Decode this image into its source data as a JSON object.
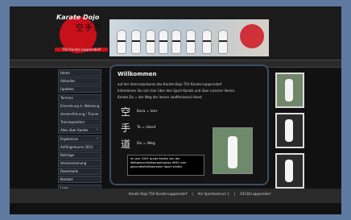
{
  "header": {
    "logo_title": "Karate Dojo",
    "logo_kanji": "空手道",
    "logo_club": "TSV Karate-Lappersdorf"
  },
  "nav": {
    "items": [
      {
        "label": "Home",
        "sub": false
      },
      {
        "label": "Aktuelles",
        "sub": false
      },
      {
        "label": "Updates",
        "sub": false
      },
      {
        "label": "Termine",
        "sub": false
      },
      {
        "label": "Einordnung d. Abteilung",
        "sub": false
      },
      {
        "label": "Vereinsführung / Trainer",
        "sub": false
      },
      {
        "label": "Trainingszeiten",
        "sub": false
      },
      {
        "label": "Alles über Karate",
        "sub": true
      },
      {
        "label": "Ergebnisse",
        "sub": true
      },
      {
        "label": "Anfängerkurse 2011",
        "sub": false
      },
      {
        "label": "Beiträge",
        "sub": false
      },
      {
        "label": "Vereinsmeinung",
        "sub": false
      },
      {
        "label": "Downloads",
        "sub": false
      },
      {
        "label": "Kontakt",
        "sub": false
      },
      {
        "label": "Links",
        "sub": false
      }
    ]
  },
  "content": {
    "title": "Willkommen",
    "intro1": "auf der Internetpräsenz des Karate-Dojo TSV Karate-Lappersdorf.",
    "intro2": "Informieren Sie sich hier über den Sport Karate und über unseren Verein.",
    "intro3": "Karate Do = der Weg der leeren (waffenlosen) Hand",
    "meanings": [
      {
        "kanji": "空",
        "text": "Kara = leer"
      },
      {
        "kanji": "手",
        "text": "Te = Hand"
      },
      {
        "kanji": "道",
        "text": "Do = Weg"
      }
    ],
    "note": "Im Jahr 2003 wurde Karate von der Weltgesundheitsorganisation WHO zum gesundheitsfördernden Sport erklärt."
  },
  "footer": {
    "parts": [
      "Karate Dojo TSV Karate-Lappersdorf",
      "|",
      "Am Sportzentrum 1",
      "|",
      "93138 Lappersdorf"
    ]
  }
}
